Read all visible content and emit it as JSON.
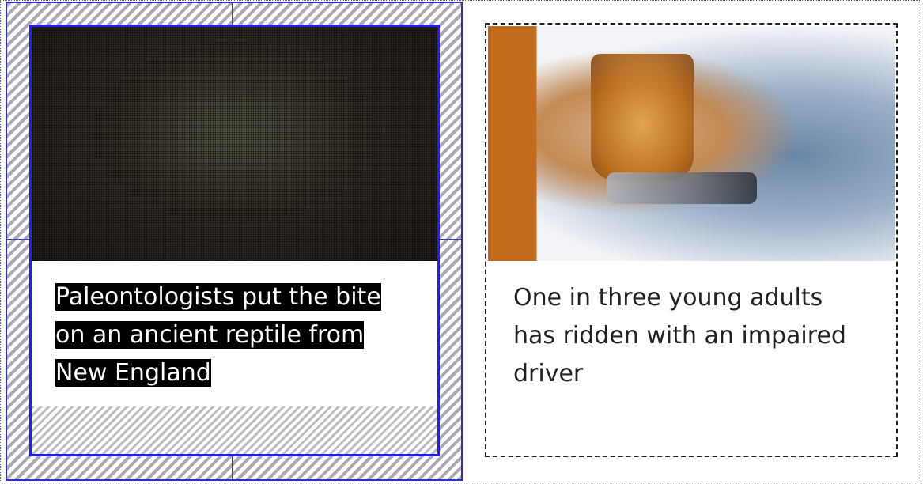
{
  "cards": [
    {
      "title_lines": [
        "Paleontologists put the bite",
        "on an ancient reptile from",
        "New England"
      ]
    },
    {
      "title_lines": [
        "One in three young adults",
        "has ridden with an impaired",
        "driver"
      ]
    }
  ]
}
